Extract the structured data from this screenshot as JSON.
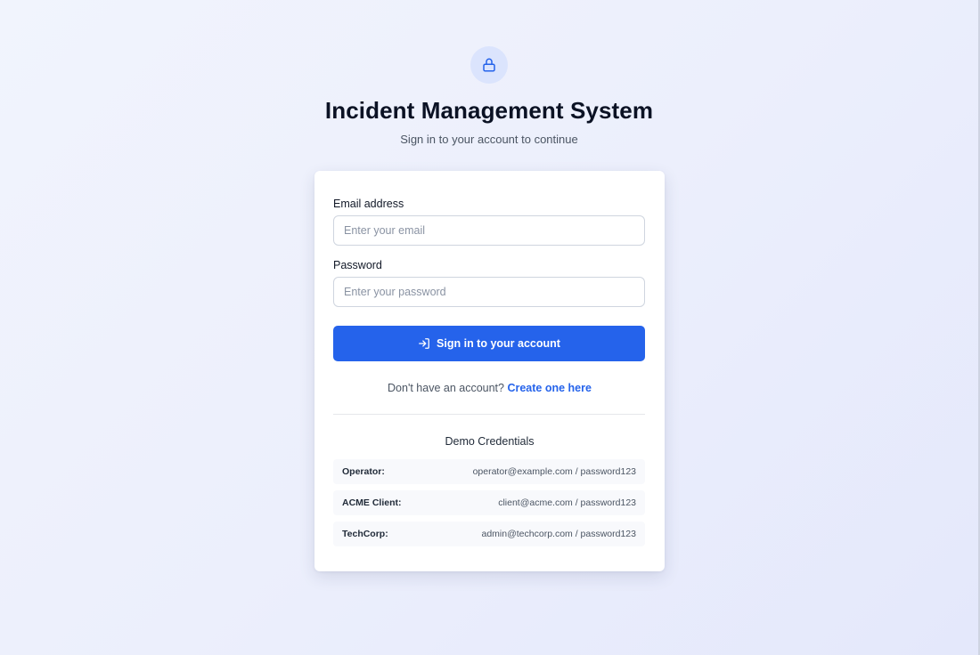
{
  "header": {
    "icon": "lock-icon",
    "title": "Incident Management System",
    "subtitle": "Sign in to your account to continue"
  },
  "form": {
    "email_label": "Email address",
    "email_value": "",
    "email_placeholder": "Enter your email",
    "password_label": "Password",
    "password_value": "",
    "password_placeholder": "Enter your password",
    "submit_label": "Sign in to your account",
    "submit_icon": "sign-in-icon"
  },
  "signup": {
    "prompt": "Don't have an account?",
    "link_label": "Create one here"
  },
  "demo": {
    "title": "Demo Credentials",
    "credentials": [
      {
        "name": "Operator:",
        "value": "operator@example.com / password123"
      },
      {
        "name": "ACME Client:",
        "value": "client@acme.com / password123"
      },
      {
        "name": "TechCorp:",
        "value": "admin@techcorp.com / password123"
      }
    ]
  },
  "colors": {
    "accent": "#2563eb",
    "icon_badge_bg": "#dbe4fd",
    "title_text": "#0b1224",
    "muted_text": "#4b5563"
  }
}
